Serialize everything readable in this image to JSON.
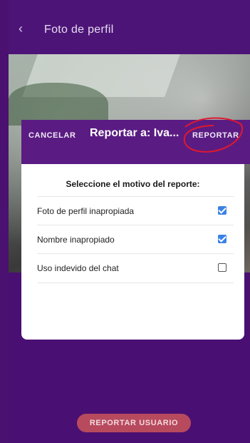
{
  "header": {
    "back_icon": "chevron-left-icon",
    "title": "Foto de perfil"
  },
  "dialog": {
    "cancel_label": "CANCELAR",
    "title": "Reportar a: Iva...",
    "report_label": "REPORTAR",
    "prompt": "Seleccione el motivo del reporte:",
    "options": [
      {
        "label": "Foto de perfil inapropiada",
        "checked": true
      },
      {
        "label": "Nombre inapropiado",
        "checked": true
      },
      {
        "label": "Uso indevido del chat",
        "checked": false
      }
    ]
  },
  "bottom_button": {
    "label": "REPORTAR USUARIO"
  },
  "colors": {
    "primary": "#4a0f72",
    "dialog_bar": "#5a1c82",
    "check": "#3b82e6",
    "annotation": "#e0182f",
    "bottom_button": "#b84a5e"
  }
}
